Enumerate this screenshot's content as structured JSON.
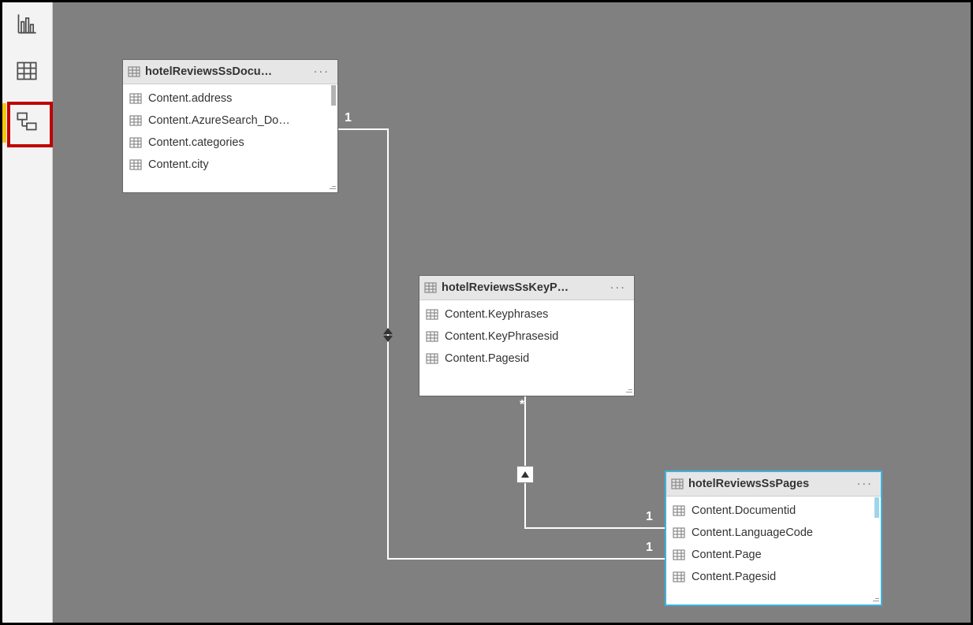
{
  "nav": {
    "report": {
      "name": "report-view"
    },
    "data": {
      "name": "data-view"
    },
    "model": {
      "name": "model-view"
    }
  },
  "tables": {
    "docu": {
      "title": "hotelReviewsSsDocu…",
      "fields": [
        "Content.address",
        "Content.AzureSearch_Do…",
        "Content.categories",
        "Content.city"
      ]
    },
    "keyp": {
      "title": "hotelReviewsSsKeyP…",
      "fields": [
        "Content.Keyphrases",
        "Content.KeyPhrasesid",
        "Content.Pagesid"
      ]
    },
    "pages": {
      "title": "hotelReviewsSsPages",
      "fields": [
        "Content.Documentid",
        "Content.LanguageCode",
        "Content.Page",
        "Content.Pagesid"
      ]
    }
  },
  "relationships": [
    {
      "from": "docu",
      "to": "pages",
      "from_card": "1",
      "to_card": "1",
      "direction": "both"
    },
    {
      "from": "keyp",
      "to": "pages",
      "from_card": "*",
      "to_card": "1",
      "direction": "single"
    }
  ],
  "labels": {
    "more": "···",
    "one": "1",
    "many": "*"
  }
}
